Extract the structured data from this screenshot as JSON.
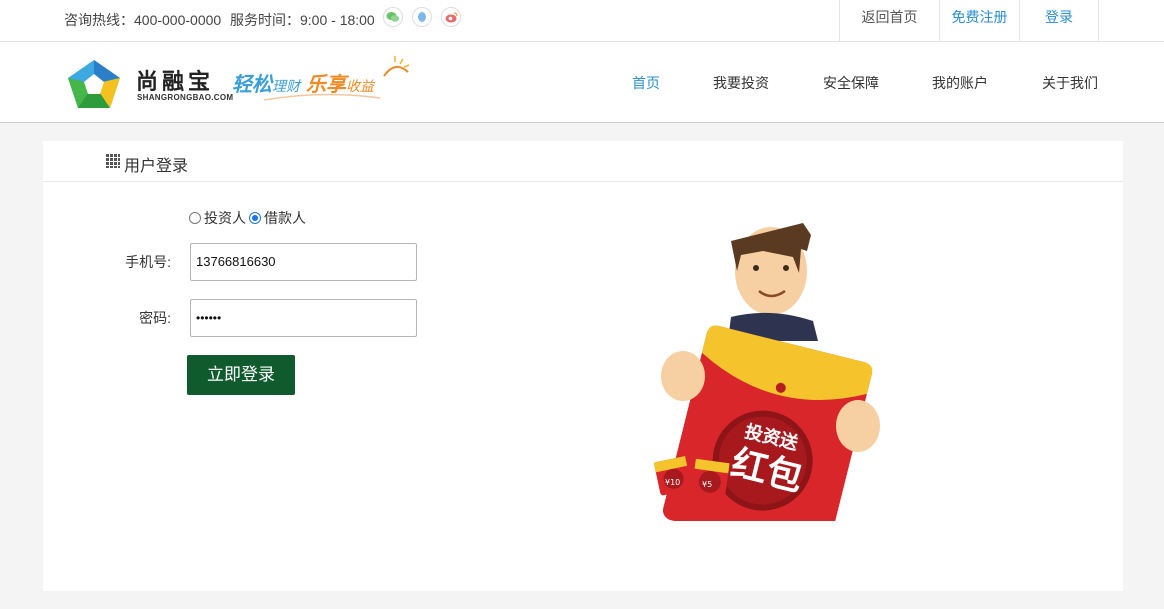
{
  "topbar": {
    "hotline": "咨询热线：400-000-0000",
    "hours": "服务时间：9:00 - 18:00",
    "social_icons": [
      "wechat-icon",
      "qq-icon",
      "weibo-icon"
    ],
    "links": [
      {
        "label": "返回首页",
        "color": "#555555"
      },
      {
        "label": "免费注册",
        "color": "#2a8fd4"
      },
      {
        "label": "登录",
        "color": "#2a8fd4"
      }
    ]
  },
  "header": {
    "brand_name": "尚融宝",
    "brand_sub": "SHANGRONGBAO.COM",
    "slogan": {
      "part1": "轻松",
      "part2": "理财",
      "part3": "乐享",
      "part4": "收益"
    },
    "nav": [
      "首页",
      "我要投资",
      "安全保障",
      "我的账户",
      "关于我们"
    ],
    "active_nav": "首页"
  },
  "login": {
    "title": "用户登录",
    "roles": [
      {
        "label": "投资人",
        "checked": false
      },
      {
        "label": "借款人",
        "checked": true
      }
    ],
    "phone_label": "手机号:",
    "phone_value": "13766816630",
    "password_label": "密码:",
    "password_value": "••••••",
    "submit_label": "立即登录"
  },
  "illustration": {
    "badge_line1": "投资送",
    "badge_line2": "红包",
    "coupon1": "¥10",
    "coupon2": "¥5"
  },
  "colors": {
    "accent": "#2a8fd4",
    "button": "#0f5b2e",
    "envelope": "#d9262b",
    "flap": "#f5c42c"
  }
}
